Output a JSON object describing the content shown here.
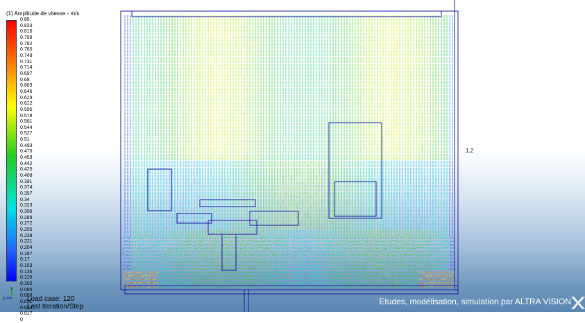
{
  "legend": {
    "title": "(1) Amplitude de vitesse - m/s",
    "values": [
      "0.85",
      "0.833",
      "0.816",
      "0.799",
      "0.782",
      "0.765",
      "0.748",
      "0.731",
      "0.714",
      "0.697",
      "0.68",
      "0.663",
      "0.646",
      "0.629",
      "0.612",
      "0.595",
      "0.578",
      "0.561",
      "0.544",
      "0.527",
      "0.51",
      "0.493",
      "0.476",
      "0.459",
      "0.442",
      "0.425",
      "0.408",
      "0.391",
      "0.374",
      "0.357",
      "0.34",
      "0.323",
      "0.306",
      "0.289",
      "0.272",
      "0.255",
      "0.238",
      "0.221",
      "0.204",
      "0.187",
      "0.17",
      "0.153",
      "0.136",
      "0.119",
      "0.102",
      "0.085",
      "0.068",
      "0.051",
      "0.034",
      "0.017",
      "0"
    ]
  },
  "status": {
    "load_case": "Load case: 120",
    "iteration": "Last Iteration/Step"
  },
  "credit": "Etudes, modélisation, simulation par ALTRA VISION",
  "dimension_label": "1.2",
  "axes": {
    "x": "x",
    "y": "y",
    "z": "z"
  },
  "colors": {
    "max": "#ff0000",
    "mid": "#22cc22",
    "min": "#0000ff"
  }
}
